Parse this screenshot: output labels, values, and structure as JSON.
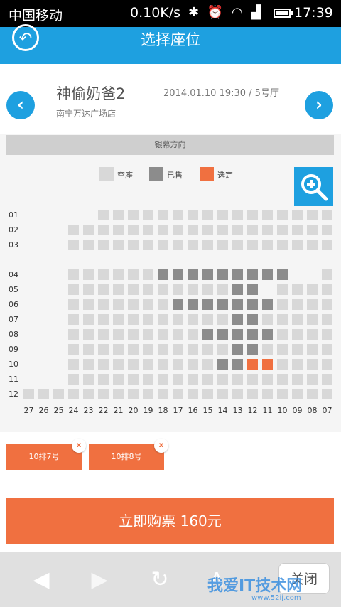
{
  "status_bar": {
    "carrier": "中国移动",
    "speed": "0.10K/s",
    "icons": [
      "bluetooth-icon",
      "alarm-icon",
      "wifi-icon",
      "signal-icon",
      "battery-icon"
    ],
    "time": "17:39"
  },
  "header": {
    "title": "选择座位"
  },
  "movie": {
    "name": "神偷奶爸2",
    "cinema": "南宁万达广场店",
    "showtime": "2014.01.10 19:30 / 5号厅"
  },
  "screen_label": "银幕方向",
  "legend": [
    {
      "label": "空座",
      "color": "#d8d8d8"
    },
    {
      "label": "已售",
      "color": "#8c8c8c"
    },
    {
      "label": "选定",
      "color": "#f07040"
    }
  ],
  "seat_map": {
    "rows": [
      "01",
      "02",
      "03",
      "",
      "04",
      "05",
      "06",
      "07",
      "08",
      "09",
      "10",
      "11",
      "12"
    ],
    "columns": [
      "27",
      "26",
      "25",
      "24",
      "23",
      "22",
      "21",
      "20",
      "19",
      "18",
      "17",
      "16",
      "15",
      "14",
      "13",
      "12",
      "11",
      "10",
      "09",
      "08",
      "07"
    ],
    "seat_codes": [
      "_____aaaaaaaaaaaaaaaa",
      "___aaaaaaaaaaaaaaaaaa",
      "___aaaaaaaaaaaaaaaaaa",
      "_____________________",
      "___aaaaaasssssssss__a",
      "___aaaaaaaaaaass_aaaa",
      "___aaaaaaasssssssaaaa",
      "___aaaaaaaaaaassaaaaa",
      "___aaaaaaaaasssssaaaa",
      "___aaaaaaaaaaassaaaaa",
      "___aaaaaaaaaassxxaaaa",
      "___aaaaaaaaaaaaaaaaaa",
      "aaaaaaaaaaaaaaaaaaaaa"
    ],
    "colors": {
      "available": "#d8d8d8",
      "sold": "#8c8c8c",
      "selected": "#f07040"
    }
  },
  "selected_seats": [
    {
      "label": "10排7号",
      "remove": "x"
    },
    {
      "label": "10排8号",
      "remove": "x"
    }
  ],
  "buy_button": "立即购票 160元",
  "bottom_nav": {
    "close_label": "关闭"
  },
  "watermark": {
    "text": "我爱IT技术网",
    "sub": "www.52ij.com"
  },
  "accent_color": "#1ea0e0"
}
